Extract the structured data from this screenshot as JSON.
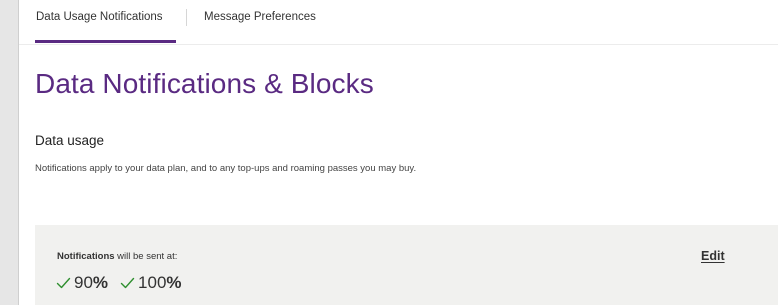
{
  "tabs": [
    {
      "label": "Data Usage Notifications",
      "active": true
    },
    {
      "label": "Message Preferences",
      "active": false
    }
  ],
  "page": {
    "title": "Data Notifications & Blocks"
  },
  "data_usage": {
    "heading": "Data usage",
    "description": "Notifications apply to your data plan, and to any top-ups and roaming passes you may buy."
  },
  "notifications": {
    "label_strong": "Notifications",
    "label_rest": " will be sent at:",
    "edit_label": "Edit",
    "thresholds": [
      {
        "value": "90",
        "unit": "%"
      },
      {
        "value": "100",
        "unit": "%"
      }
    ]
  },
  "colors": {
    "brand_purple": "#5a2a82",
    "check_green": "#2f8f2f",
    "panel_bg": "#f1f1ef"
  },
  "icons": {
    "threshold_check": "check-icon"
  }
}
